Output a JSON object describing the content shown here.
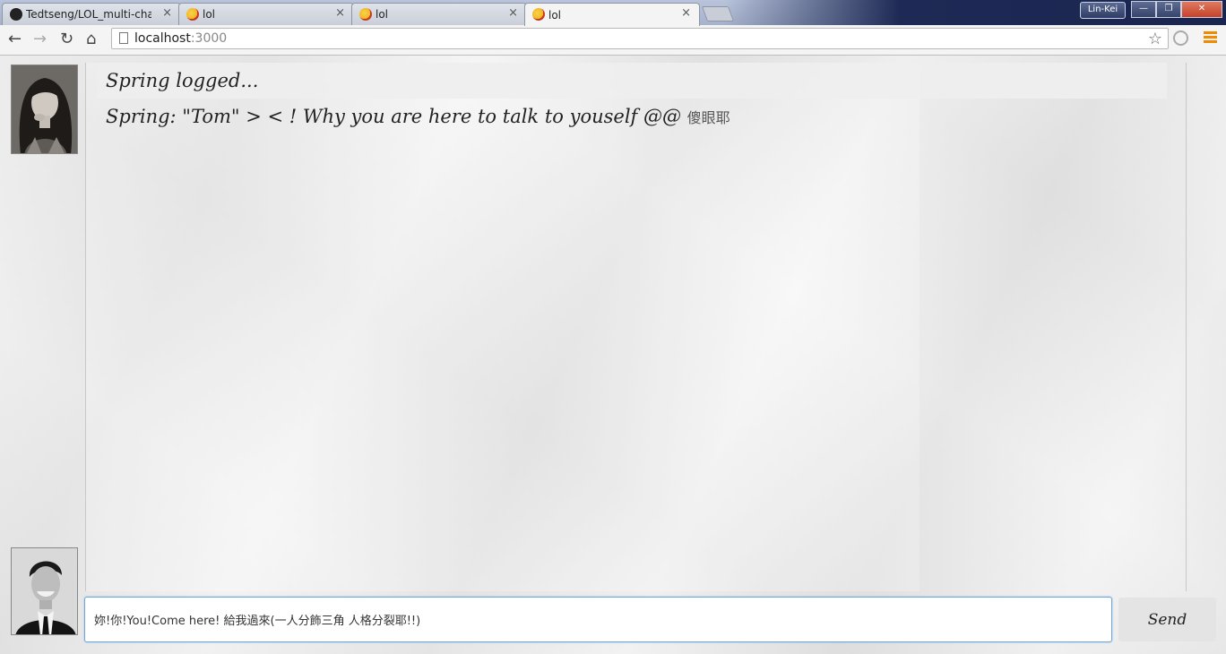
{
  "browser": {
    "tabs": [
      {
        "title": "Tedtseng/LOL_multi-chat-",
        "icon": "github-icon",
        "active": false
      },
      {
        "title": "lol",
        "icon": "lol-favicon-icon",
        "active": false
      },
      {
        "title": "lol",
        "icon": "lol-favicon-icon",
        "active": false
      },
      {
        "title": "lol",
        "icon": "lol-favicon-icon",
        "active": true
      }
    ],
    "close_glyph": "×",
    "user_badge": "Lin-Kei",
    "window_buttons": {
      "minimize": "—",
      "maximize": "❐",
      "close": "✕"
    },
    "url_host": "localhost",
    "url_port": ":3000",
    "nav": {
      "back": "←",
      "forward": "→",
      "reload": "↻",
      "home": "⌂",
      "bookmark": "☆"
    }
  },
  "chat": {
    "messages": [
      {
        "type": "system",
        "text": "Spring logged..."
      },
      {
        "type": "chat",
        "text": "Spring: \"Tom\" > < ! Why you are here to talk to youself @@ ",
        "cjk": "傻眼耶"
      }
    ],
    "input_value": "妳!你!You!Come here! 給我過來(一人分飾三角 人格分裂耶!!)",
    "send_label": "Send"
  },
  "colors": {
    "accent_border": "#6fa6d6",
    "menu_icon": "#f08a00"
  }
}
